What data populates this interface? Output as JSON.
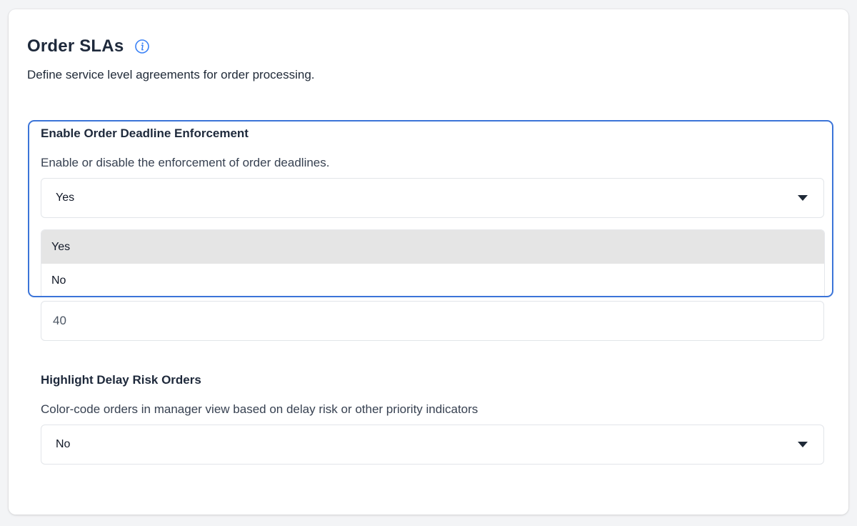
{
  "header": {
    "title": "Order SLAs",
    "info_icon": "info-icon",
    "subtitle": "Define service level agreements for order processing."
  },
  "fields": {
    "deadline_enforcement": {
      "label": "Enable Order Deadline Enforcement",
      "description": "Enable or disable the enforcement of order deadlines.",
      "selected_value": "Yes",
      "options": [
        "Yes",
        "No"
      ],
      "highlighted_option": "Yes"
    },
    "hidden_number_field": {
      "value": "40"
    },
    "highlight_delay_risk": {
      "label": "Highlight Delay Risk Orders",
      "description": "Color-code orders in manager view based on delay risk or other priority indicators",
      "selected_value": "No"
    }
  },
  "colors": {
    "focus_ring": "#3b74d8",
    "option_highlight": "#e5e5e5",
    "info_icon": "#3b82f6"
  }
}
